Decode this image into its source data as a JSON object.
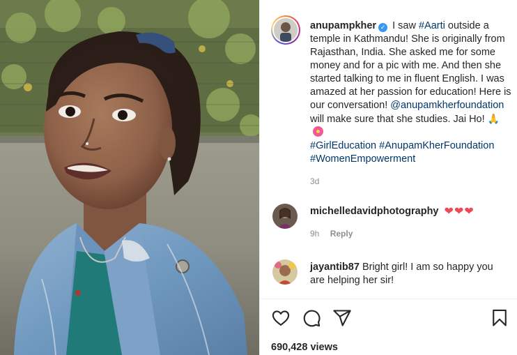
{
  "post": {
    "author": "anupampkher",
    "verified": true,
    "caption_parts": {
      "p1": "I saw ",
      "tag1": "#Aarti",
      "p2": " outside a temple in Kathmandu! She is originally from Rajasthan, India. She asked me for some money and for a pic with me. And then she started talking to me in fluent English. I was amazed at her passion for education! Here is our conversation! ",
      "mention": "@anupamkherfoundation",
      "p3": " will make sure that she studies. Jai Ho! ",
      "emoji1": "🙏",
      "tag2": "#GirlEducation",
      "tag3": "#AnupamKherFoundation",
      "tag4": "#WomenEmpowerment"
    },
    "time": "3d",
    "views": "690,428 views"
  },
  "comments": [
    {
      "username": "michelledavidphotography",
      "text": "",
      "hearts": "❤❤❤",
      "time": "9h",
      "reply_label": "Reply"
    },
    {
      "username": "jayantib87",
      "text": "Bright girl! I am so happy you are helping her sir!"
    }
  ],
  "icons": [
    "heart-outline-icon",
    "comment-bubble-icon",
    "paper-plane-icon",
    "bookmark-icon",
    "verified-badge-icon"
  ],
  "colors": {
    "link": "#00376b",
    "verified": "#3897f0",
    "heart": "#ed4956",
    "muted": "#8e8e8e",
    "text": "#262626"
  }
}
